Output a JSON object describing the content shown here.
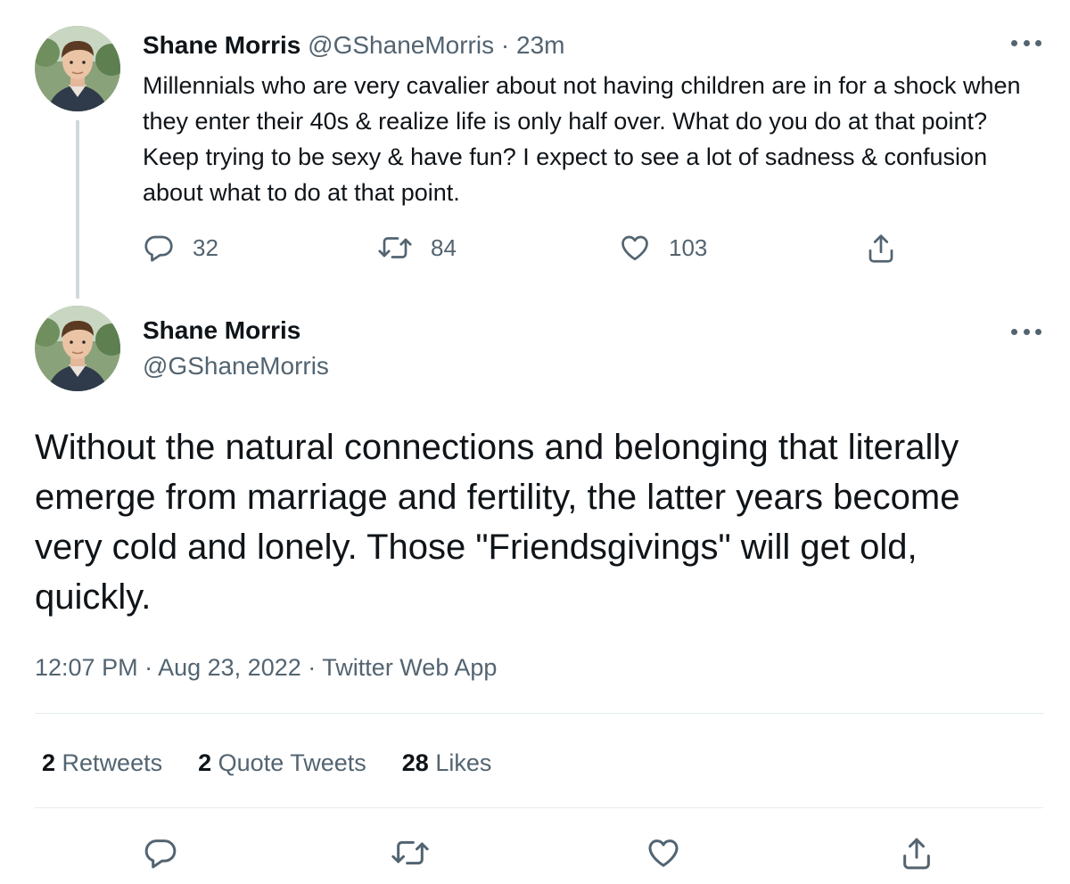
{
  "parent_tweet": {
    "author_name": "Shane Morris",
    "handle": "@GShaneMorris",
    "separator": "·",
    "time": "23m",
    "text": "Millennials who are very cavalier about not having children are in for a shock when they enter their 40s & realize life is only half over. What do you do at that point? Keep trying to be sexy & have fun? I expect to see a lot of sadness & confusion about what to do at that point.",
    "replies": "32",
    "retweets": "84",
    "likes": "103"
  },
  "main_tweet": {
    "author_name": "Shane Morris",
    "handle": "@GShaneMorris",
    "text": "Without the natural connections and belonging that literally emerge from marriage and fertility, the latter years become very cold and lonely. Those \"Friendsgivings\" will get old, quickly.",
    "time": "12:07 PM",
    "separator": "·",
    "date": "Aug 23, 2022",
    "source": "Twitter Web App",
    "stats": {
      "retweets_count": "2",
      "retweets_label": "Retweets",
      "quote_count": "2",
      "quote_label": "Quote Tweets",
      "likes_count": "28",
      "likes_label": "Likes"
    }
  },
  "icons": {
    "reply": "reply-icon",
    "retweet": "retweet-icon",
    "like": "heart-icon",
    "share": "share-icon",
    "more": "more-icon"
  },
  "colors": {
    "primary_text": "#0f1419",
    "secondary_text": "#536471",
    "thread_line": "#cfd9de",
    "divider": "#e6ecf0"
  }
}
